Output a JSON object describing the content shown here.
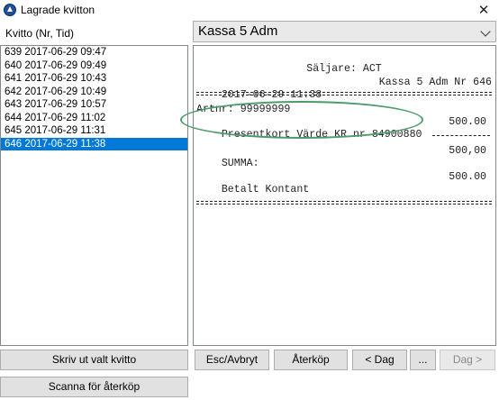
{
  "window": {
    "title": "Lagrade kvitton",
    "close_glyph": "✕"
  },
  "list": {
    "header": "Kvitto (Nr, Tid)",
    "items": [
      "639 2017-06-29 09:47",
      "640 2017-06-29 09:49",
      "641 2017-06-29 10:43",
      "642 2017-06-29 10:49",
      "643 2017-06-29 10:57",
      "644 2017-06-29 11:02",
      "645 2017-06-29 11:31",
      "646 2017-06-29 11:38"
    ],
    "selected_index": 7
  },
  "kassa": {
    "selected": "Kassa 5 Adm"
  },
  "receipt": {
    "seller": "Säljare: ACT",
    "date": "2017-06-29 11:38",
    "register": "Kassa 5 Adm Nr 646",
    "art_nr": "Artnr: 99999999",
    "item_desc": "Presentkort Värde KR nr 84900880",
    "item_amount": "500.00",
    "sum_label": "SUMMA:",
    "sum_amount": "500,00",
    "paid_label": "Betalt Kontant",
    "paid_amount": "500.00"
  },
  "buttons": {
    "print_selected": "Skriv ut valt kvitto",
    "scan_return": "Scanna för återköp",
    "cancel": "Esc/Avbryt",
    "return": "Återköp",
    "prev_day": "< Dag",
    "more": "...",
    "next_day": "Dag >"
  },
  "colors": {
    "selection": "#0078d7",
    "annotation": "#4c9b6a"
  }
}
